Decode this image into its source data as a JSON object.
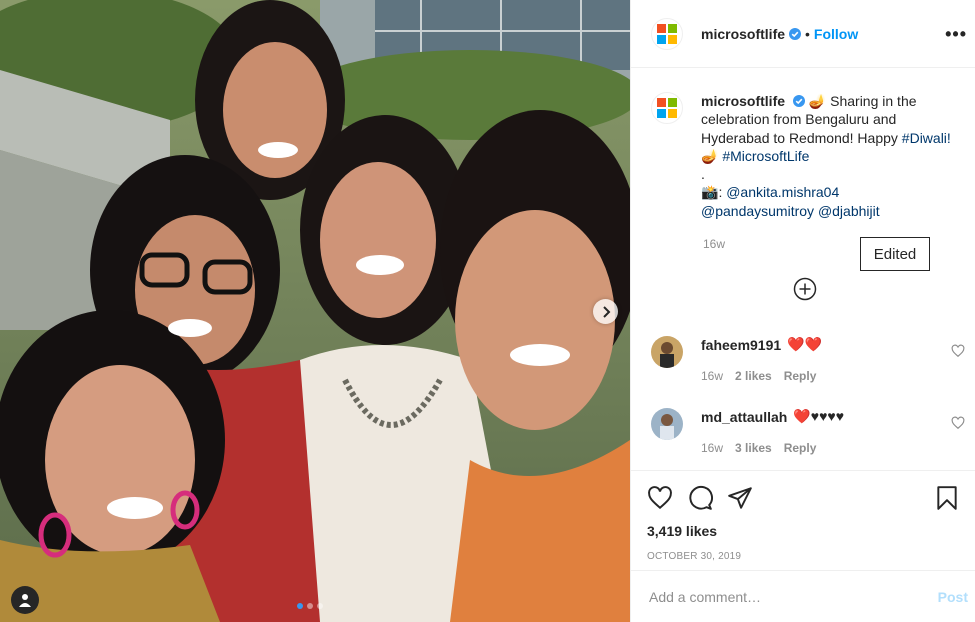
{
  "post": {
    "username": "microsoftlife",
    "follow_label": "Follow",
    "separator": "•",
    "more_label": "•••"
  },
  "caption": {
    "username": "microsoftlife",
    "emoji_1": "🪔",
    "text_1": "Sharing in the celebration from Bengaluru and Hyderabad to Redmond! Happy",
    "hashtag_1": "#Diwali!",
    "emoji_2": "🪔",
    "hashtag_2": "#MicrosoftLife",
    "dot": ".",
    "camera_emoji": "📸",
    "colon": ":",
    "mention_1": "@ankita.mishra04",
    "mention_2": "@pandaysumitroy",
    "mention_3": "@djabhijit",
    "time": "16w"
  },
  "tooltip": {
    "label": "Edited"
  },
  "comments": [
    {
      "username": "faheem9191",
      "text": "❤️❤️",
      "time": "16w",
      "likes": "2 likes",
      "reply": "Reply"
    },
    {
      "username": "md_attaullah",
      "text": "❤️♥♥♥♥",
      "time": "16w",
      "likes": "3 likes",
      "reply": "Reply"
    }
  ],
  "likes_count": "3,419 likes",
  "date": "October 30, 2019",
  "add_comment": {
    "placeholder": "Add a comment…",
    "post_label": "Post"
  },
  "carousel": {
    "total": 3,
    "active": 0
  },
  "colors": {
    "accent": "#0095f6",
    "link": "#00376b",
    "ms_red": "#f25022",
    "ms_green": "#7fba00",
    "ms_blue": "#00a4ef",
    "ms_yellow": "#ffb900",
    "like_red": "#ed4956"
  },
  "icons": [
    "heart-icon",
    "comment-icon",
    "share-icon",
    "bookmark-icon",
    "verified-icon",
    "plus-circle-icon",
    "chevron-right-icon",
    "user-tag-icon"
  ]
}
